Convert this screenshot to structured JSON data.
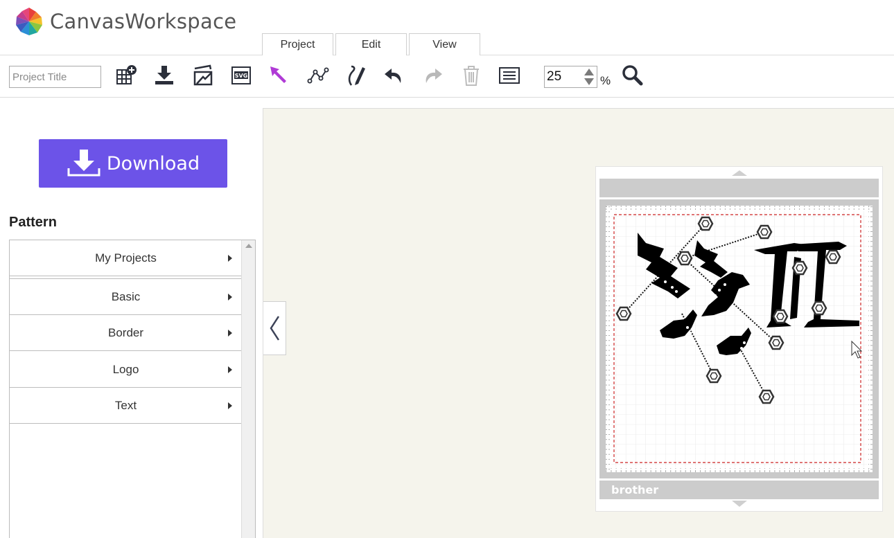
{
  "app": {
    "title": "CanvasWorkspace"
  },
  "tabs": [
    {
      "label": "Project"
    },
    {
      "label": "Edit"
    },
    {
      "label": "View"
    }
  ],
  "toolbar": {
    "project_title_placeholder": "Project Title",
    "tools": [
      "new-project-icon",
      "import-icon",
      "export-icon",
      "svg-export-icon",
      "select-arrow-icon",
      "node-edit-icon",
      "draw-tool-icon",
      "undo-icon",
      "redo-icon",
      "trash-icon",
      "object-list-icon"
    ],
    "zoom_value": "25",
    "zoom_unit": "%",
    "zoom_icon": "magnifier-icon"
  },
  "side": {
    "download_label": "Download",
    "pattern_heading": "Pattern",
    "pattern_items": [
      {
        "label": "My Projects"
      },
      {
        "label": "Basic"
      },
      {
        "label": "Border"
      },
      {
        "label": "Logo"
      },
      {
        "label": "Text"
      }
    ]
  },
  "mat": {
    "brand": "brother"
  },
  "colors": {
    "accent": "#6c53e8",
    "select_tool": "#b03ad6",
    "cut_line": "#cc2222",
    "workspace_bg": "#f5f4ec"
  }
}
